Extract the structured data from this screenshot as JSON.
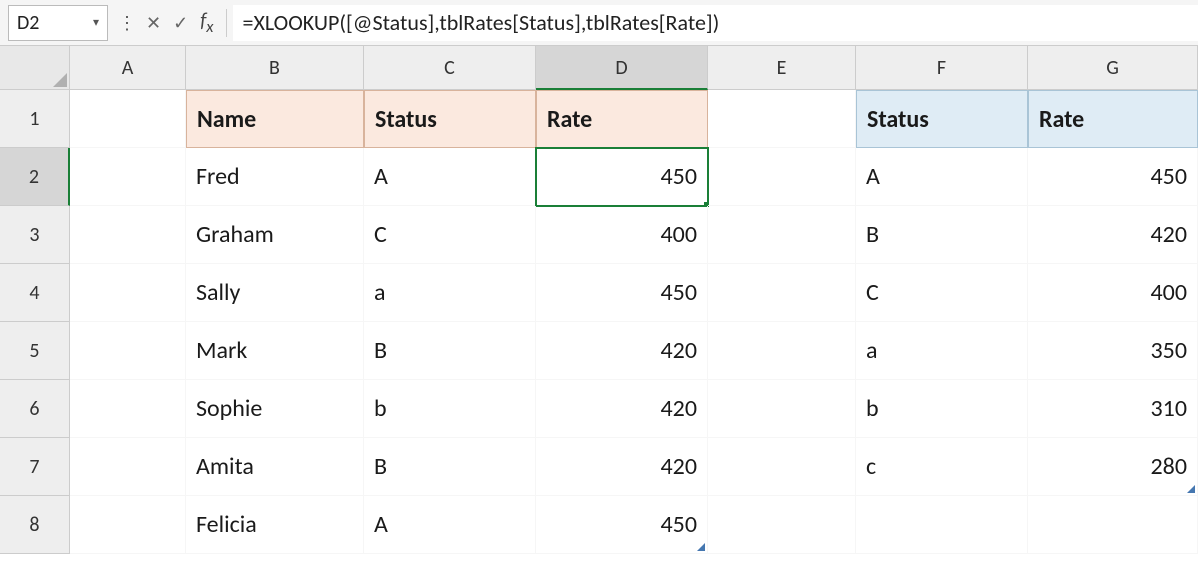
{
  "nameBox": {
    "value": "D2"
  },
  "formulaBar": {
    "formula": "=XLOOKUP([@Status],tblRates[Status],tblRates[Rate])"
  },
  "columnHeaders": [
    "A",
    "B",
    "C",
    "D",
    "E",
    "F",
    "G"
  ],
  "rowHeaders": [
    "1",
    "2",
    "3",
    "4",
    "5",
    "6",
    "7",
    "8"
  ],
  "selectedCell": "D2",
  "mainTable": {
    "headers": {
      "name": "Name",
      "status": "Status",
      "rate": "Rate"
    },
    "rows": [
      {
        "name": "Fred",
        "status": "A",
        "rate": "450"
      },
      {
        "name": "Graham",
        "status": "C",
        "rate": "400"
      },
      {
        "name": "Sally",
        "status": "a",
        "rate": "450"
      },
      {
        "name": "Mark",
        "status": "B",
        "rate": "420"
      },
      {
        "name": "Sophie",
        "status": "b",
        "rate": "420"
      },
      {
        "name": "Amita",
        "status": "B",
        "rate": "420"
      },
      {
        "name": "Felicia",
        "status": "A",
        "rate": "450"
      }
    ]
  },
  "ratesTable": {
    "headers": {
      "status": "Status",
      "rate": "Rate"
    },
    "rows": [
      {
        "status": "A",
        "rate": "450"
      },
      {
        "status": "B",
        "rate": "420"
      },
      {
        "status": "C",
        "rate": "400"
      },
      {
        "status": "a",
        "rate": "350"
      },
      {
        "status": "b",
        "rate": "310"
      },
      {
        "status": "c",
        "rate": "280"
      }
    ]
  }
}
